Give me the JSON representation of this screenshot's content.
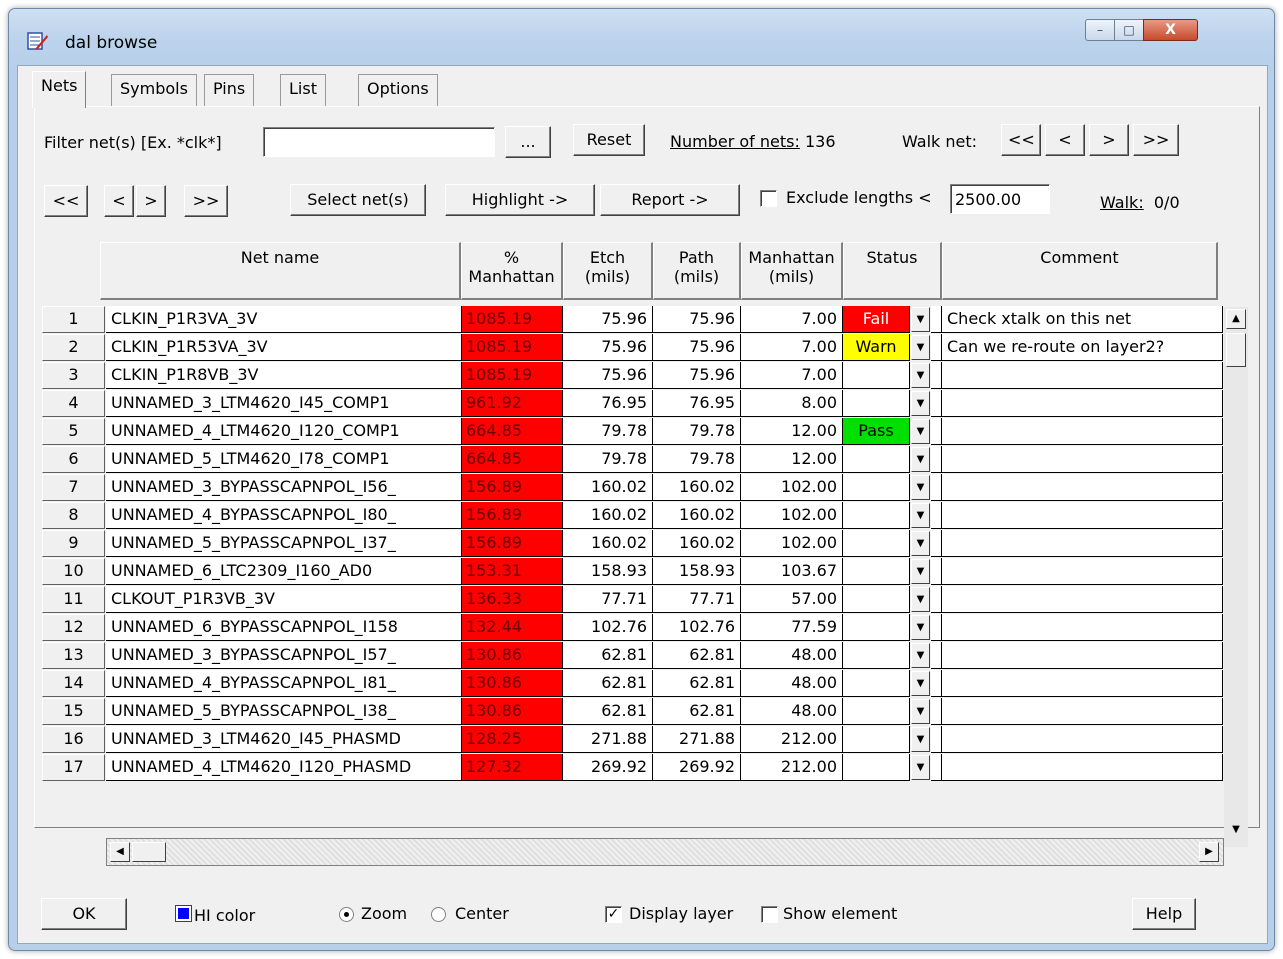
{
  "window": {
    "title": "dal browse",
    "minimize": "–",
    "maximize": "□",
    "close": "X"
  },
  "tabs": [
    "Nets",
    "Symbols",
    "Pins",
    "List",
    "Options"
  ],
  "filter": {
    "label": "Filter net(s) [Ex. *clk*]",
    "value": "",
    "browse_label": "...",
    "reset_label": "Reset",
    "count_label": "Number of nets:",
    "count_value": "136"
  },
  "walk_net": {
    "label": "Walk net:",
    "first": "<<",
    "prev": "<",
    "next": ">",
    "last": ">>"
  },
  "nav": {
    "first": "<<",
    "prev": "<",
    "next": ">",
    "last": ">>"
  },
  "actions": {
    "select_nets": "Select net(s)",
    "highlight": "Highlight ->",
    "report": "Report ->",
    "exclude_label": "Exclude lengths <",
    "exclude_value": "2500.00",
    "exclude_checked": false,
    "walk_label": "Walk:",
    "walk_value": "0/0"
  },
  "table": {
    "columns": [
      {
        "line1": "Net name",
        "line2": ""
      },
      {
        "line1": "%",
        "line2": "Manhattan"
      },
      {
        "line1": "Etch",
        "line2": "(mils)"
      },
      {
        "line1": "Path",
        "line2": "(mils)"
      },
      {
        "line1": "Manhattan",
        "line2": "(mils)"
      },
      {
        "line1": "Status",
        "line2": ""
      },
      {
        "line1": "Comment",
        "line2": ""
      }
    ],
    "status_colors": {
      "Fail": "#ff0000",
      "Warn": "#ffff00",
      "Pass": "#00e000"
    },
    "pct_color": "#ff0000",
    "rows": [
      {
        "n": "1",
        "name": "CLKIN_P1R3VA_3V",
        "pct": "1085.19",
        "etch": "75.96",
        "path": "75.96",
        "manh": "7.00",
        "status": "Fail",
        "comment": "Check xtalk on this net"
      },
      {
        "n": "2",
        "name": "CLKIN_P1R53VA_3V",
        "pct": "1085.19",
        "etch": "75.96",
        "path": "75.96",
        "manh": "7.00",
        "status": "Warn",
        "comment": "Can we re-route on layer2?"
      },
      {
        "n": "3",
        "name": "CLKIN_P1R8VB_3V",
        "pct": "1085.19",
        "etch": "75.96",
        "path": "75.96",
        "manh": "7.00",
        "status": "",
        "comment": ""
      },
      {
        "n": "4",
        "name": "UNNAMED_3_LTM4620_I45_COMP1",
        "pct": "961.92",
        "etch": "76.95",
        "path": "76.95",
        "manh": "8.00",
        "status": "",
        "comment": ""
      },
      {
        "n": "5",
        "name": "UNNAMED_4_LTM4620_I120_COMP1",
        "pct": "664.85",
        "etch": "79.78",
        "path": "79.78",
        "manh": "12.00",
        "status": "Pass",
        "comment": ""
      },
      {
        "n": "6",
        "name": "UNNAMED_5_LTM4620_I78_COMP1",
        "pct": "664.85",
        "etch": "79.78",
        "path": "79.78",
        "manh": "12.00",
        "status": "",
        "comment": ""
      },
      {
        "n": "7",
        "name": "UNNAMED_3_BYPASSCAPNPOL_I56_",
        "pct": "156.89",
        "etch": "160.02",
        "path": "160.02",
        "manh": "102.00",
        "status": "",
        "comment": ""
      },
      {
        "n": "8",
        "name": "UNNAMED_4_BYPASSCAPNPOL_I80_",
        "pct": "156.89",
        "etch": "160.02",
        "path": "160.02",
        "manh": "102.00",
        "status": "",
        "comment": ""
      },
      {
        "n": "9",
        "name": "UNNAMED_5_BYPASSCAPNPOL_I37_",
        "pct": "156.89",
        "etch": "160.02",
        "path": "160.02",
        "manh": "102.00",
        "status": "",
        "comment": ""
      },
      {
        "n": "10",
        "name": "UNNAMED_6_LTC2309_I160_AD0",
        "pct": "153.31",
        "etch": "158.93",
        "path": "158.93",
        "manh": "103.67",
        "status": "",
        "comment": ""
      },
      {
        "n": "11",
        "name": "CLKOUT_P1R3VB_3V",
        "pct": "136.33",
        "etch": "77.71",
        "path": "77.71",
        "manh": "57.00",
        "status": "",
        "comment": ""
      },
      {
        "n": "12",
        "name": "UNNAMED_6_BYPASSCAPNPOL_I158",
        "pct": "132.44",
        "etch": "102.76",
        "path": "102.76",
        "manh": "77.59",
        "status": "",
        "comment": ""
      },
      {
        "n": "13",
        "name": "UNNAMED_3_BYPASSCAPNPOL_I57_",
        "pct": "130.86",
        "etch": "62.81",
        "path": "62.81",
        "manh": "48.00",
        "status": "",
        "comment": ""
      },
      {
        "n": "14",
        "name": "UNNAMED_4_BYPASSCAPNPOL_I81_",
        "pct": "130.86",
        "etch": "62.81",
        "path": "62.81",
        "manh": "48.00",
        "status": "",
        "comment": ""
      },
      {
        "n": "15",
        "name": "UNNAMED_5_BYPASSCAPNPOL_I38_",
        "pct": "130.86",
        "etch": "62.81",
        "path": "62.81",
        "manh": "48.00",
        "status": "",
        "comment": ""
      },
      {
        "n": "16",
        "name": "UNNAMED_3_LTM4620_I45_PHASMD",
        "pct": "128.25",
        "etch": "271.88",
        "path": "271.88",
        "manh": "212.00",
        "status": "",
        "comment": ""
      },
      {
        "n": "17",
        "name": "UNNAMED_4_LTM4620_I120_PHASMD",
        "pct": "127.32",
        "etch": "269.92",
        "path": "269.92",
        "manh": "212.00",
        "status": "",
        "comment": ""
      }
    ]
  },
  "footer": {
    "ok": "OK",
    "hi_color_label": "HI color",
    "hi_color": "#0000ff",
    "zoom_label": "Zoom",
    "zoom_selected": true,
    "center_label": "Center",
    "display_layer_label": "Display layer",
    "display_layer_checked": true,
    "show_element_label": "Show element",
    "show_element_checked": false,
    "help": "Help"
  }
}
